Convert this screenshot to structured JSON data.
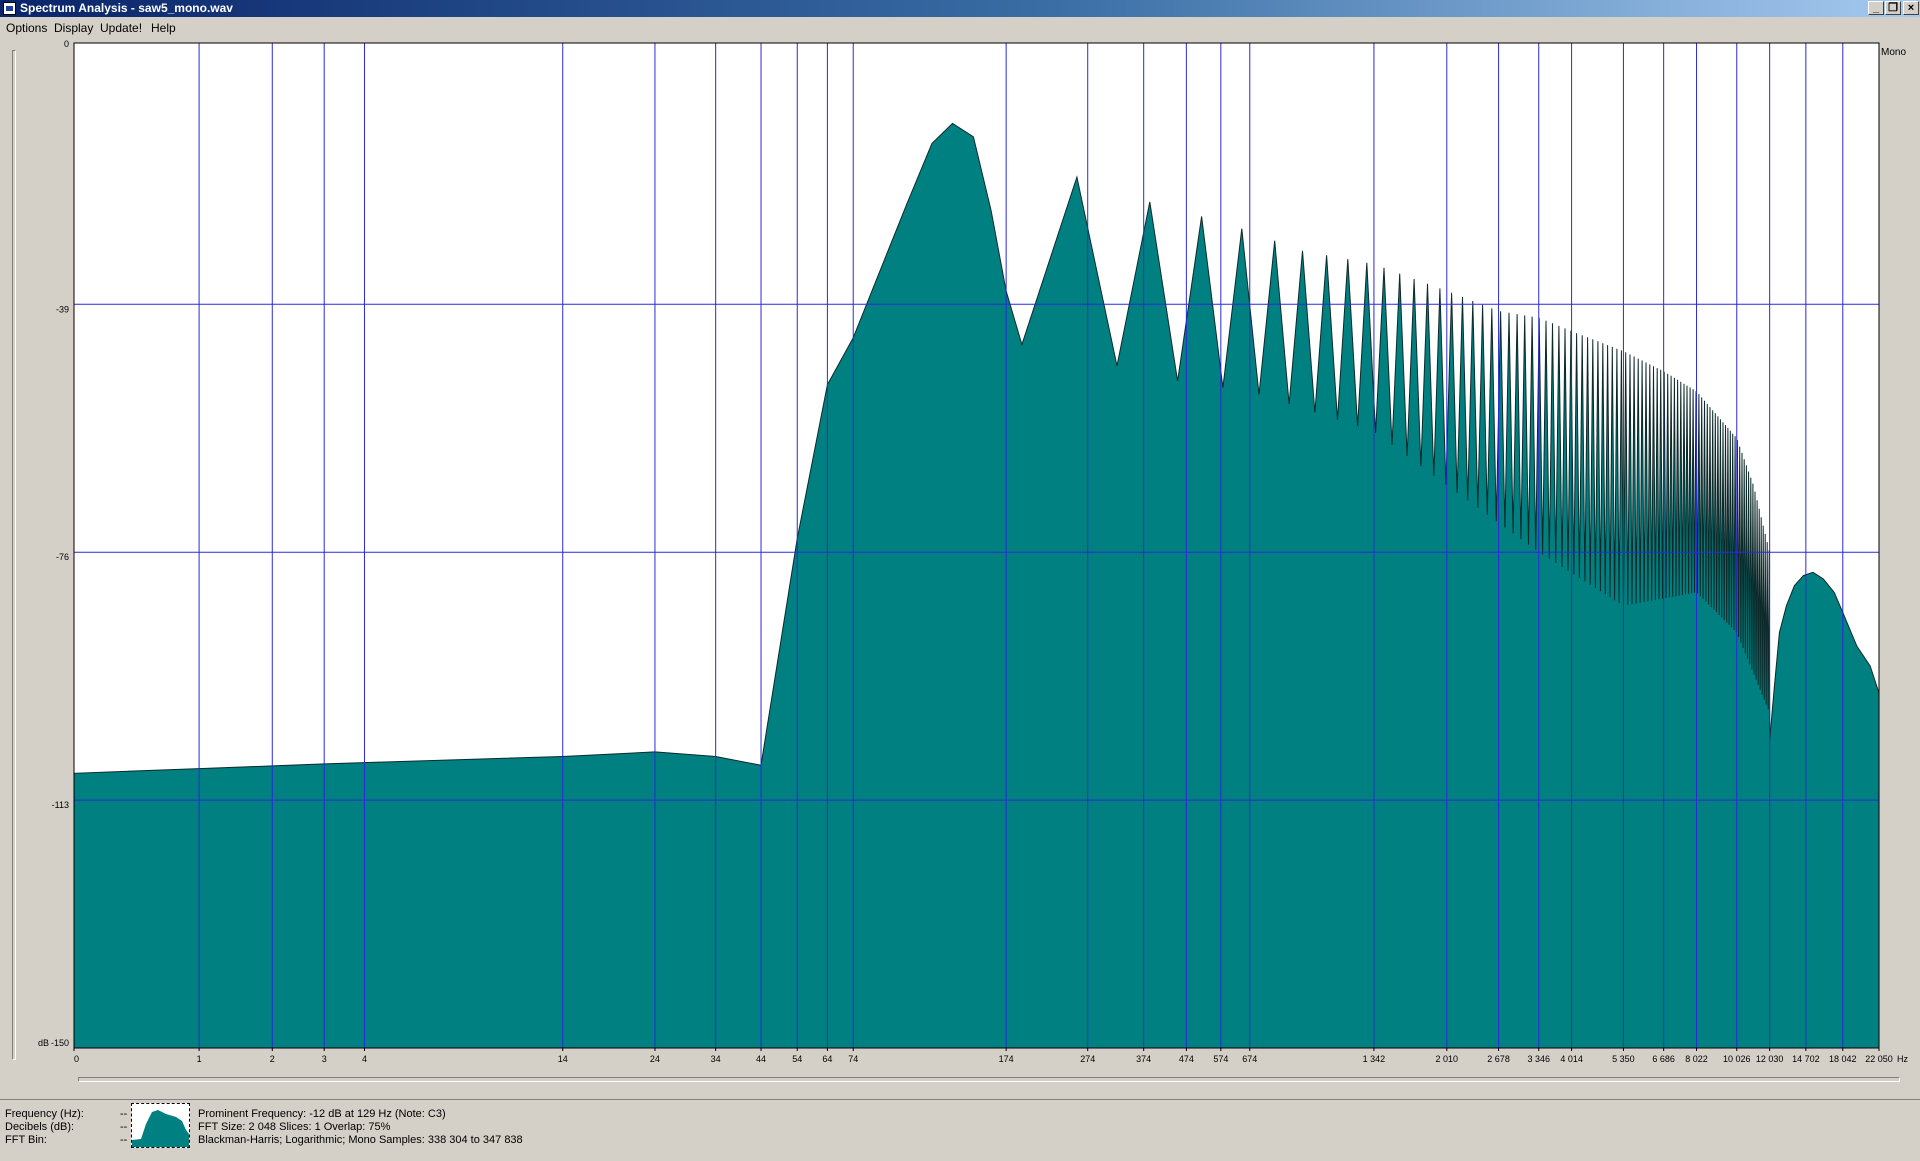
{
  "window": {
    "title": "Spectrum Analysis - saw5_mono.wav",
    "controls": {
      "minimize": "_",
      "restore": "❐",
      "close": "×"
    }
  },
  "menu": [
    "Options",
    "Display",
    "Update!",
    "Help"
  ],
  "chart_data": {
    "type": "area",
    "channel_label": "Mono",
    "x_scale": "log",
    "x_unit": "Hz",
    "xlim": [
      0,
      22050
    ],
    "ylim": [
      -150,
      0
    ],
    "y_ticks": [
      "0",
      "-39",
      "-76",
      "-113",
      "-150"
    ],
    "y_unit": "dB",
    "x_ticks": [
      "0",
      "1",
      "2",
      "3",
      "4",
      "14",
      "24",
      "34",
      "44",
      "54",
      "64",
      "74",
      "174",
      "274",
      "374",
      "474",
      "574",
      "674",
      "1 342",
      "2 010",
      "2 678",
      "3 346",
      "4 014",
      "5 350",
      "6 686",
      "8 022",
      "10 026",
      "12 030",
      "14 702",
      "18 042",
      "22 050"
    ],
    "grid": true,
    "fill_color": "#008080",
    "grid_color": "#2a2ad8",
    "fundamental_hz": 129,
    "peak_db": -12,
    "floor_points": [
      [
        0,
        -109
      ],
      [
        1,
        -108.3
      ],
      [
        2,
        -107.9
      ],
      [
        3,
        -107.6
      ],
      [
        4,
        -107.4
      ],
      [
        14,
        -106.5
      ],
      [
        24,
        -105.8
      ],
      [
        34,
        -106.5
      ],
      [
        44,
        -107.8
      ]
    ],
    "rise_points": [
      [
        44,
        -107.8
      ],
      [
        54,
        -74
      ],
      [
        64,
        -51
      ],
      [
        74,
        -44
      ],
      [
        86,
        -34
      ],
      [
        100,
        -24
      ],
      [
        115,
        -15
      ],
      [
        129,
        -12
      ],
      [
        145,
        -14
      ],
      [
        160,
        -25
      ],
      [
        174,
        -37
      ],
      [
        190,
        -45
      ]
    ],
    "harmonic_envelope": [
      [
        258,
        -20
      ],
      [
        400,
        -24
      ],
      [
        600,
        -27
      ],
      [
        900,
        -31
      ],
      [
        1342,
        -33
      ],
      [
        2010,
        -37
      ],
      [
        2678,
        -40
      ],
      [
        3346,
        -41
      ],
      [
        4014,
        -43
      ],
      [
        5350,
        -46
      ],
      [
        6686,
        -49
      ],
      [
        8022,
        -52
      ],
      [
        10026,
        -59
      ],
      [
        11000,
        -66
      ],
      [
        12030,
        -76
      ],
      [
        12500,
        -86
      ]
    ],
    "valley_envelope": [
      [
        220,
        -45
      ],
      [
        400,
        -50
      ],
      [
        674,
        -52
      ],
      [
        1342,
        -58
      ],
      [
        2010,
        -66
      ],
      [
        3346,
        -76
      ],
      [
        5350,
        -84
      ],
      [
        8022,
        -82
      ],
      [
        10026,
        -88
      ],
      [
        12030,
        -100
      ]
    ],
    "lobe_points": [
      [
        12030,
        -104
      ],
      [
        12350,
        -96
      ],
      [
        12700,
        -88
      ],
      [
        13200,
        -84
      ],
      [
        13800,
        -81
      ],
      [
        14500,
        -79.5
      ],
      [
        15300,
        -79
      ],
      [
        16200,
        -80
      ],
      [
        17200,
        -82
      ],
      [
        18042,
        -85
      ],
      [
        19500,
        -90
      ],
      [
        21000,
        -93
      ],
      [
        22050,
        -97
      ]
    ]
  },
  "status": {
    "labels": [
      "Frequency (Hz):",
      "Decibels (dB):",
      "FFT Bin:"
    ],
    "dashes": [
      "--",
      "--",
      "--"
    ],
    "lines": [
      "Prominent Frequency: -12 dB at 129 Hz (Note: C3)",
      "FFT Size: 2 048  Slices: 1  Overlap: 75%",
      "Blackman-Harris; Logarithmic; Mono  Samples: 338 304 to 347 838"
    ]
  }
}
